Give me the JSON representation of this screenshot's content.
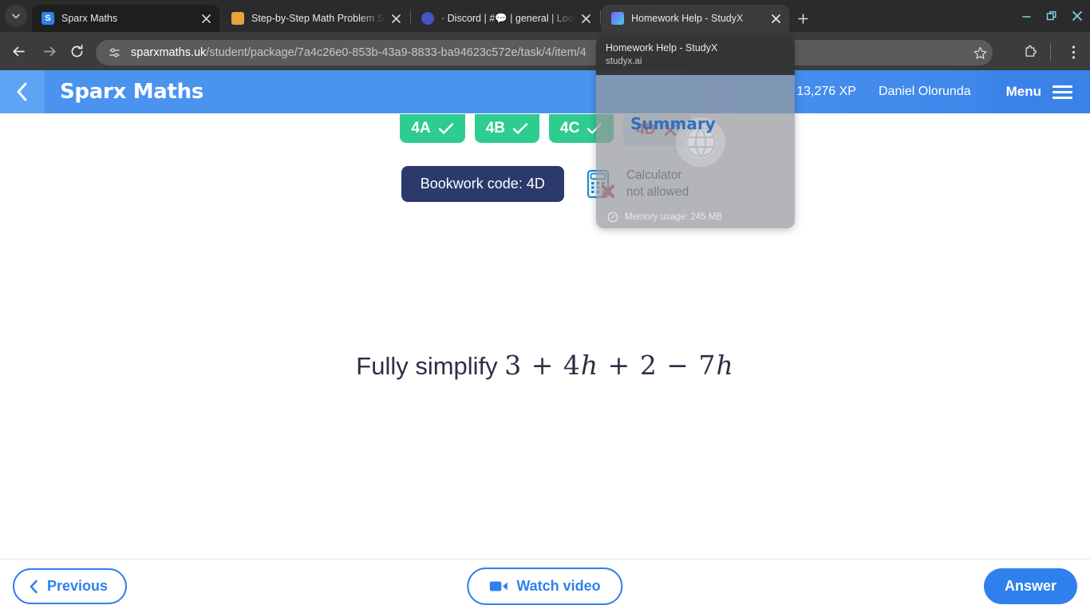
{
  "browser": {
    "tab_list_icon": "chevron-down-icon",
    "new_tab_label": "+",
    "tabs": [
      {
        "title": "Sparx Maths",
        "favicon": "sparx-icon",
        "active": true
      },
      {
        "title": "Step-by-Step Math Problem Sol",
        "favicon": "step-by-step-icon",
        "active": false
      },
      {
        "title": "· Discord | #💬 | general | Loot",
        "favicon": "discord-icon",
        "active": false
      },
      {
        "title": "Homework Help - StudyX",
        "favicon": "studyx-icon",
        "active": false
      }
    ],
    "window_controls": {
      "minimize": "minimize-icon",
      "maximize": "restore-icon",
      "close": "close-icon"
    },
    "nav": {
      "back": "back-arrow-icon",
      "forward": "forward-arrow-icon",
      "reload": "reload-icon"
    },
    "omnibox": {
      "site_settings_icon": "tune-icon",
      "url_host": "sparxmaths.uk",
      "url_path": "/student/package/7a4c26e0-853b-43a9-8833-ba94623c572e/task/4/item/4",
      "bookmark_icon": "star-icon"
    },
    "toolbar_right": {
      "extensions_icon": "puzzle-icon",
      "menu_icon": "three-dot-menu-icon"
    }
  },
  "tab_preview": {
    "title": "Homework Help - StudyX",
    "url": "studyx.ai",
    "memory_icon": "speedometer-icon",
    "memory_label": "Memory usage: 245 MB"
  },
  "app": {
    "back_icon": "chevron-left-icon",
    "title": "Sparx Maths",
    "xp": "13,276 XP",
    "user": "Daniel Olorunda",
    "menu_label": "Menu",
    "menu_icon": "hamburger-icon",
    "badges": [
      {
        "label": "4A",
        "state": "done",
        "icon": "check-icon"
      },
      {
        "label": "4B",
        "state": "done",
        "icon": "check-icon"
      },
      {
        "label": "4C",
        "state": "done",
        "icon": "check-icon"
      },
      {
        "label": "4D",
        "state": "current",
        "icon": "cross-icon"
      }
    ],
    "bookwork_code": "Bookwork code: 4D",
    "calculator_icon": "calculator-disallowed-icon",
    "calculator_line1": "Calculator",
    "calculator_line2": "not allowed",
    "question": {
      "prefix": "Fully simplify ",
      "math_plain": "3 + 4h + 2 − 7h",
      "math_tokens": [
        "3",
        "+",
        "4",
        "h",
        "+",
        "2",
        "−",
        "7",
        "h"
      ]
    },
    "summary_label": "Summary",
    "footer": {
      "previous_label": "Previous",
      "previous_icon": "chevron-left-icon",
      "watch_video_label": "Watch video",
      "watch_video_icon": "video-camera-icon",
      "answer_label": "Answer"
    }
  },
  "colors": {
    "brand_blue": "#2f80ed",
    "header_blue": "#4a94f0",
    "success_green": "#2ecc8f",
    "error_red": "#c62828",
    "bookwork_navy": "#2b3a6b"
  }
}
